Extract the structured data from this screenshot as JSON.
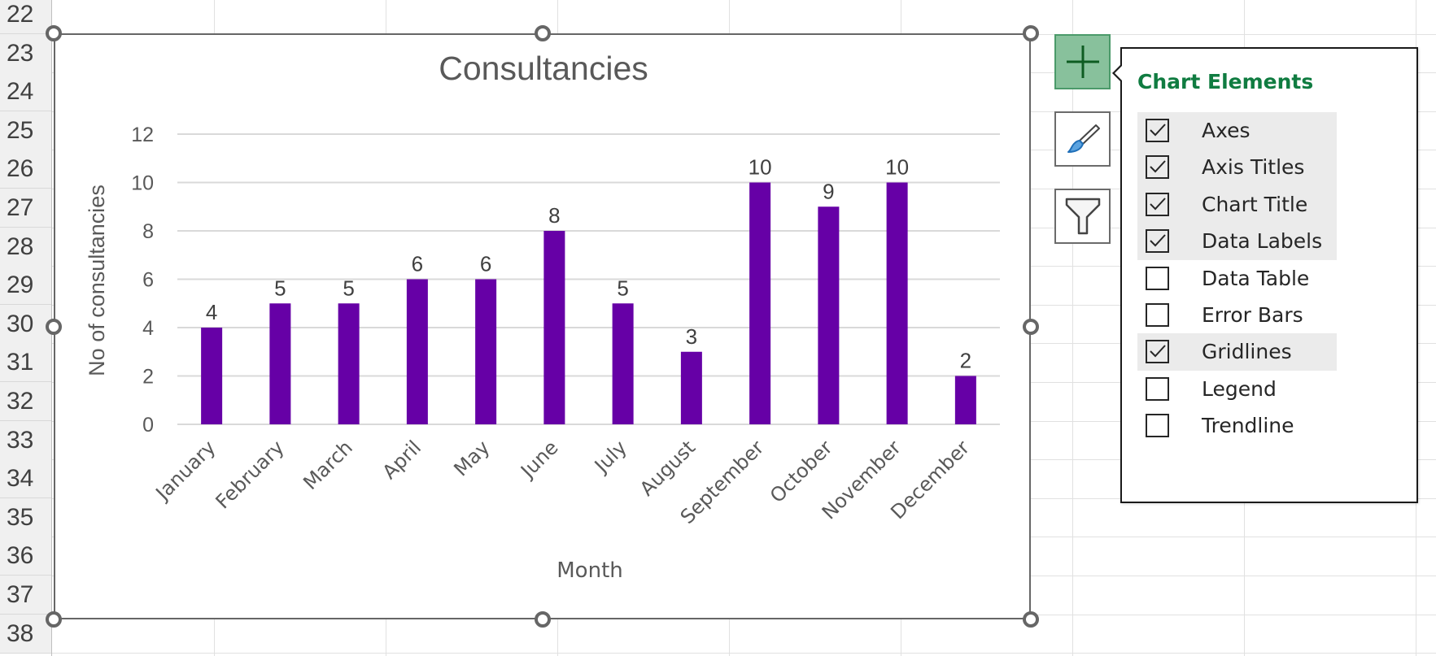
{
  "sheet": {
    "row_numbers": [
      "22",
      "23",
      "24",
      "25",
      "26",
      "27",
      "28",
      "29",
      "30",
      "31",
      "32",
      "33",
      "34",
      "35",
      "36",
      "37",
      "38"
    ]
  },
  "chart_data": {
    "type": "bar",
    "title": "Consultancies",
    "xlabel": "Month",
    "ylabel": "No of consultancies",
    "categories": [
      "January",
      "February",
      "March",
      "April",
      "May",
      "June",
      "July",
      "August",
      "September",
      "October",
      "November",
      "December"
    ],
    "values": [
      4,
      5,
      5,
      6,
      6,
      8,
      5,
      3,
      10,
      9,
      10,
      2
    ],
    "ylim": [
      0,
      12
    ],
    "yticks": [
      0,
      2,
      4,
      6,
      8,
      10,
      12
    ],
    "grid": true,
    "legend": "none",
    "data_labels": true,
    "bar_color": "#6600a6",
    "x_label_rotation": "-45deg"
  },
  "side_buttons": {
    "elements": "Chart Elements",
    "styles": "Chart Styles",
    "filters": "Chart Filters"
  },
  "panel": {
    "title": "Chart Elements",
    "accent": "#107c41",
    "items": [
      {
        "label": "Axes",
        "checked": true
      },
      {
        "label": "Axis Titles",
        "checked": true
      },
      {
        "label": "Chart Title",
        "checked": true
      },
      {
        "label": "Data Labels",
        "checked": true
      },
      {
        "label": "Data Table",
        "checked": false
      },
      {
        "label": "Error Bars",
        "checked": false
      },
      {
        "label": "Gridlines",
        "checked": true
      },
      {
        "label": "Legend",
        "checked": false
      },
      {
        "label": "Trendline",
        "checked": false
      }
    ]
  }
}
